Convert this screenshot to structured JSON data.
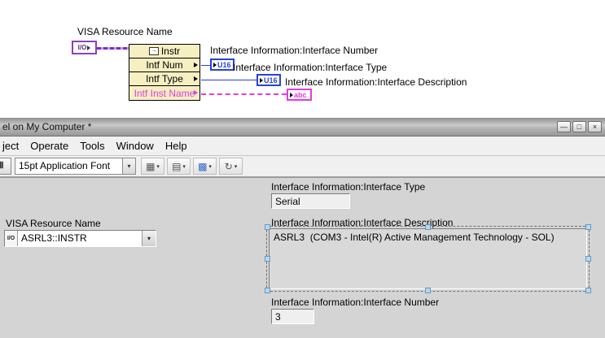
{
  "diagram": {
    "visa_resource_label": "VISA Resource Name",
    "visa_icon_text": "I/O",
    "property_node": {
      "rows": [
        {
          "label": "Instr"
        },
        {
          "label": "Intf Num"
        },
        {
          "label": "Intf Type"
        },
        {
          "label": "Intf Inst Name"
        }
      ]
    },
    "outputs": [
      {
        "label": "Interface Information:Interface Number",
        "terminal": "U16"
      },
      {
        "label": "Interface Information:Interface Type",
        "terminal": "U16"
      },
      {
        "label": "Interface Information:Interface Description",
        "terminal": "abc"
      }
    ]
  },
  "window": {
    "title": "el on My Computer *",
    "menu": {
      "items": [
        {
          "label": "ject"
        },
        {
          "label": "Operate"
        },
        {
          "label": "Tools"
        },
        {
          "label": "Window"
        },
        {
          "label": "Help"
        }
      ]
    },
    "toolbar": {
      "font_selector": "15pt Application Font"
    }
  },
  "panel": {
    "visa": {
      "label": "VISA Resource Name",
      "icon_text": "I/O",
      "value": "ASRL3::INSTR"
    },
    "interface_type": {
      "label": "Interface Information:Interface Type",
      "value": "Serial"
    },
    "interface_description": {
      "label": "Interface Information:Interface Description",
      "value": "ASRL3  (COM3 - Intel(R) Active Management Technology - SOL)"
    },
    "interface_number": {
      "label": "Interface Information:Interface Number",
      "value": "3"
    }
  },
  "icons": {
    "minimize": "—",
    "maximize": "□",
    "close": "×",
    "pause": "Ⅱ",
    "dropdown": "▾",
    "row_icon": "→",
    "align": "▦",
    "distribute": "▤",
    "resize": "▩",
    "reorder": "↻"
  },
  "colors": {
    "visa_purple": "#8c3fc0",
    "integer_blue": "#2742d6",
    "string_pink": "#e23ae2",
    "node_yellow": "#f6efc2",
    "panel_gray": "#d4d4d4"
  }
}
